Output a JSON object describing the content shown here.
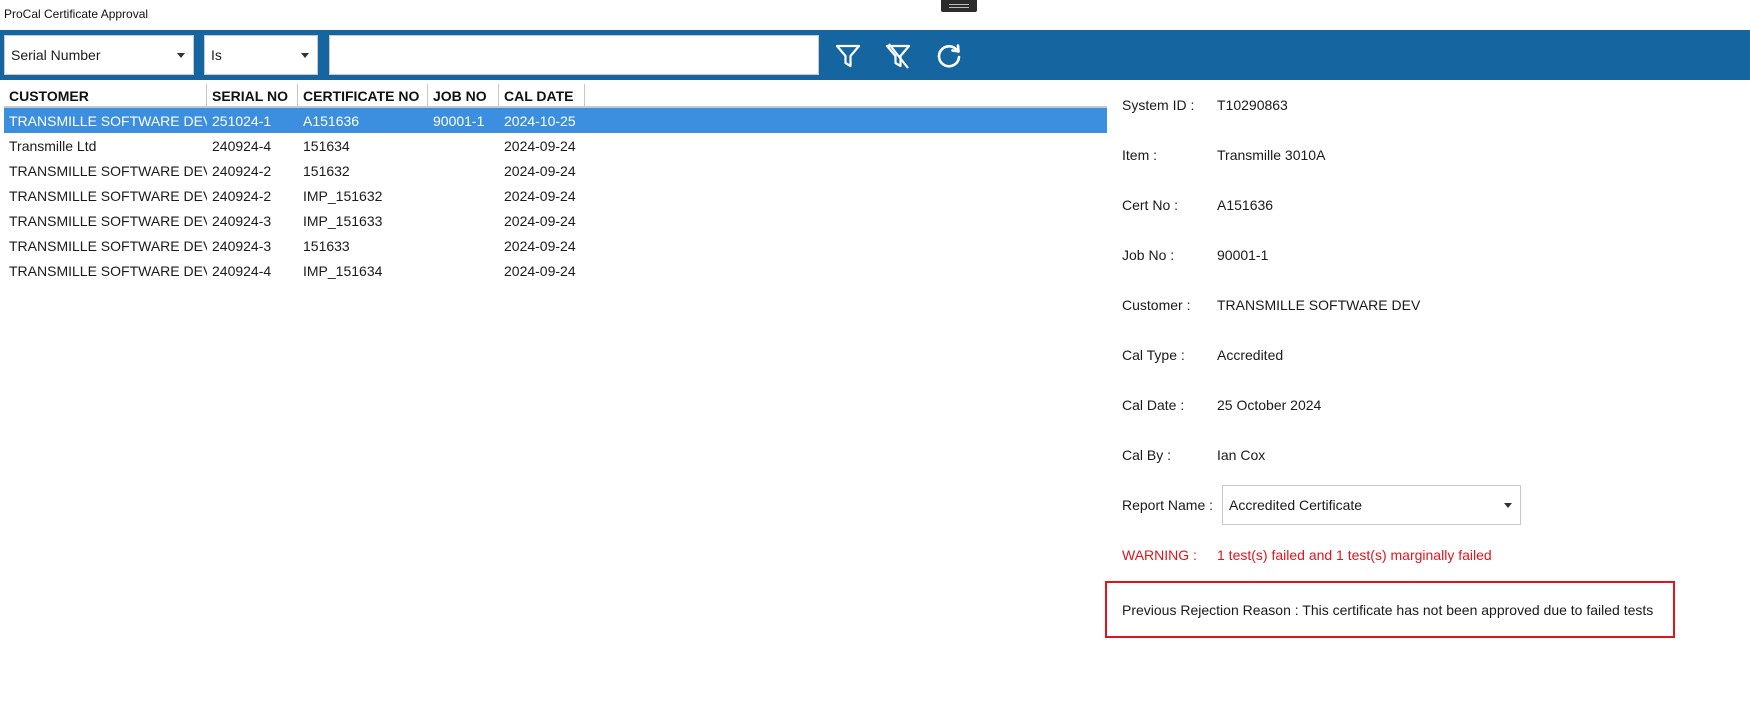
{
  "window": {
    "title": "ProCal Certificate Approval"
  },
  "filter": {
    "field": "Serial Number",
    "operator": "Is",
    "value": "",
    "accent": "#1565a0"
  },
  "icons": {
    "apply_filter": "filter-icon",
    "clear_filter": "clear-filter-icon",
    "refresh": "refresh-icon"
  },
  "grid": {
    "headers": [
      "CUSTOMER",
      "SERIAL NO",
      "CERTIFICATE NO",
      "JOB NO",
      "CAL DATE"
    ],
    "rows": [
      [
        "TRANSMILLE SOFTWARE DEV",
        "251024-1",
        "A151636",
        "90001-1",
        "2024-10-25"
      ],
      [
        "Transmille Ltd",
        "240924-4",
        "151634",
        "",
        "2024-09-24"
      ],
      [
        "TRANSMILLE SOFTWARE DEV",
        "240924-2",
        "151632",
        "",
        "2024-09-24"
      ],
      [
        "TRANSMILLE SOFTWARE DEV",
        "240924-2",
        "IMP_151632",
        "",
        "2024-09-24"
      ],
      [
        "TRANSMILLE SOFTWARE DEV",
        "240924-3",
        "IMP_151633",
        "",
        "2024-09-24"
      ],
      [
        "TRANSMILLE SOFTWARE DEV",
        "240924-3",
        "151633",
        "",
        "2024-09-24"
      ],
      [
        "TRANSMILLE SOFTWARE DEV",
        "240924-4",
        "IMP_151634",
        "",
        "2024-09-24"
      ]
    ],
    "selected_index": 0,
    "selected_color": "#3c8fde"
  },
  "details": {
    "system_id": {
      "label": "System ID :",
      "value": "T10290863"
    },
    "item": {
      "label": "Item :",
      "value": "Transmille 3010A"
    },
    "cert_no": {
      "label": "Cert No :",
      "value": "A151636"
    },
    "job_no": {
      "label": "Job No :",
      "value": "90001-1"
    },
    "customer": {
      "label": "Customer :",
      "value": "TRANSMILLE SOFTWARE DEV"
    },
    "cal_type": {
      "label": "Cal Type :",
      "value": "Accredited"
    },
    "cal_date": {
      "label": "Cal Date :",
      "value": "25 October 2024"
    },
    "cal_by": {
      "label": "Cal By :",
      "value": "Ian Cox"
    },
    "report_name": {
      "label": "Report Name :",
      "value": "Accredited Certificate"
    },
    "warning": {
      "label": "WARNING :",
      "value": "1 test(s) failed and 1 test(s) marginally failed",
      "color": "#e0141e"
    },
    "rejection": "Previous Rejection Reason : This certificate has not been approved due to failed tests"
  }
}
